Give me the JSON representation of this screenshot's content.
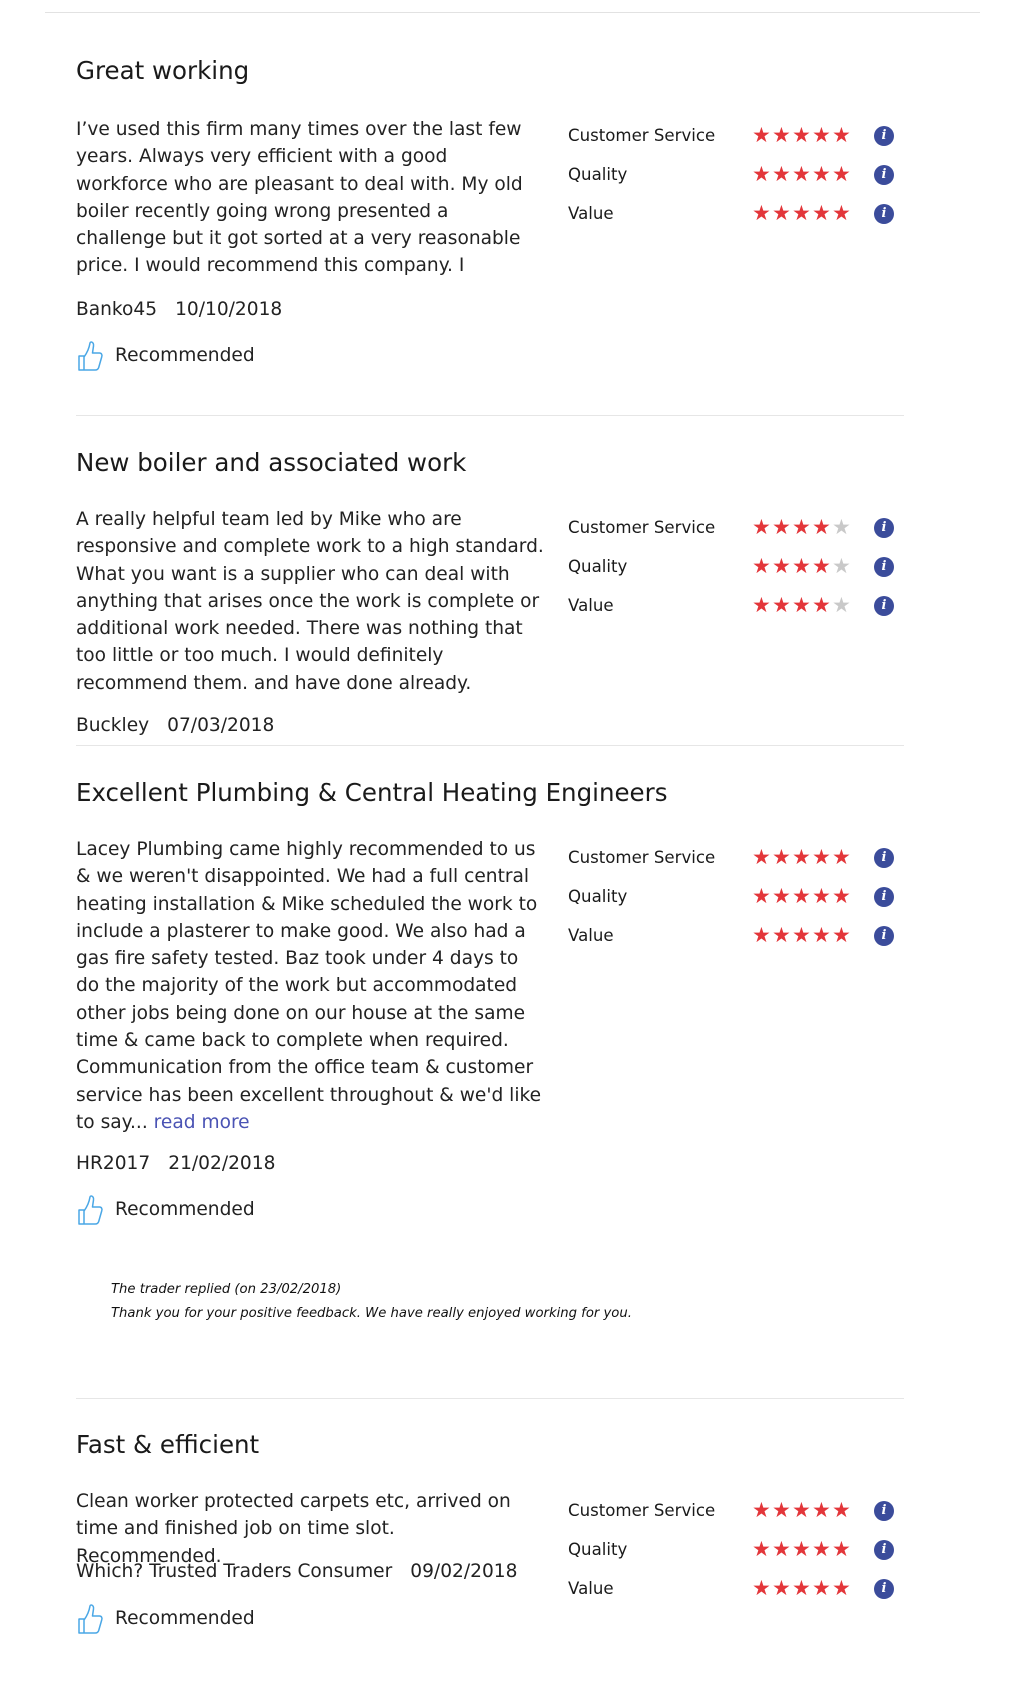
{
  "recommended_label": "Recommended",
  "rating_labels": [
    "Customer Service",
    "Quality",
    "Value"
  ],
  "colors": {
    "star_on": "#e3363a",
    "star_off": "#c9c9c9",
    "info_bg": "#3b4c9b",
    "link": "#4a53b4"
  },
  "reviews": [
    {
      "title": "Great working",
      "body": "I’ve used this firm many times over the last few years. Always very efficient with a good workforce who are pleasant to deal with. My old boiler recently going wrong presented a challenge but it got sorted at a very reasonable price. I would recommend this company. I",
      "author": "Banko45",
      "date": "10/10/2018",
      "recommended": true,
      "ratings": [
        5,
        5,
        5
      ]
    },
    {
      "title": "New boiler and associated work",
      "body": "A really helpful team led by Mike who are responsive and complete work to a high standard. What you want is a supplier who can deal with anything that arises once the work is complete or additional work needed. There was nothing that too little or too much. I would definitely recommend them. and have done already.",
      "author": "Buckley",
      "date": "07/03/2018",
      "recommended": false,
      "ratings": [
        4,
        4,
        4
      ]
    },
    {
      "title": "Excellent Plumbing & Central Heating Engineers",
      "body": "Lacey Plumbing came highly recommended to us & we weren't disappointed. We had a full central heating installation & Mike scheduled the work to include a plasterer to make good. We also had a gas fire safety tested. Baz took under 4 days to do the majority of the work but accommodated other jobs being done on our house at the same time & came back to complete when required. Communication from the office team & customer service has been excellent throughout & we'd like to say...",
      "read_more": "read more",
      "author": "HR2017",
      "date": "21/02/2018",
      "recommended": true,
      "ratings": [
        5,
        5,
        5
      ],
      "reply_header": "The trader replied (on 23/02/2018)",
      "reply_text": "Thank you for your positive feedback. We have really enjoyed working for you."
    },
    {
      "title": "Fast & efficient",
      "body": "Clean worker protected carpets etc, arrived on time and finished job on time slot. Recommended.",
      "author": "Which? Trusted Traders Consumer",
      "date": "09/02/2018",
      "recommended": true,
      "ratings": [
        5,
        5,
        5
      ]
    }
  ]
}
